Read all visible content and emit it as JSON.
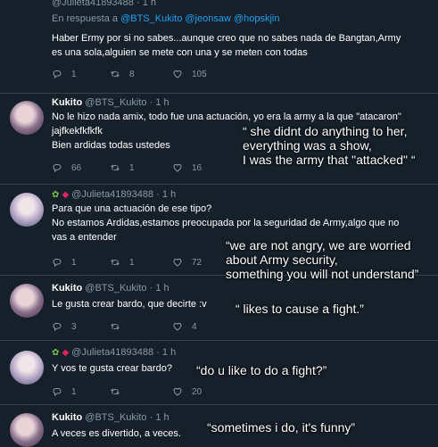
{
  "tweet1": {
    "name": "@Julieta41893488",
    "time": "· 1 h",
    "reply_prefix": "En respuesta a",
    "reply_handles": "@BTS_Kukito @jeonsaw @hopskjin",
    "line1": "Haber Ermy por si no sabes...aunque creo que no sabes nada de Bangtan,Army",
    "line2": "es una sola,alguien se mete con una y se meten con todas",
    "replies": "1",
    "retweets": "8",
    "likes": "105"
  },
  "tweet2": {
    "name": "Kukito",
    "handle": "@BTS_Kukito",
    "time": "· 1 h",
    "line1": "No le hizo nada amix, todo fue una actuación, yo era la army a la que \"atacaron\"",
    "line2": "jajfkekfkfkfk",
    "line3": "Bien ardidas todas ustedes",
    "replies": "66",
    "retweets": "1",
    "likes": "16"
  },
  "tweet3": {
    "name": "@Julieta41893488",
    "time": "· 1 h",
    "line1": "Para que una actuación de ese tipo?",
    "line2": "No estamos Ardidas,estamos preocupada por la seguridad de Army,algo que no",
    "line3": "vas a entender",
    "replies": "1",
    "retweets": "1",
    "likes": "72"
  },
  "tweet4": {
    "name": "Kukito",
    "handle": "@BTS_Kukito",
    "time": "· 1 h",
    "line1": "Le gusta crear bardo, que decirte :v",
    "replies": "3",
    "retweets": "",
    "likes": "4"
  },
  "tweet5": {
    "name": "@Julieta41893488",
    "time": "· 1 h",
    "line1": "Y vos te gusta crear bardo?",
    "replies": "1",
    "retweets": "",
    "likes": "20"
  },
  "tweet6": {
    "name": "Kukito",
    "handle": "@BTS_Kukito",
    "time": "· 1 h",
    "line1": "A veces es divertido, a veces."
  },
  "overlays": {
    "o1_l1": "“ she didnt do anything to her,",
    "o1_l2": "everything was a show,",
    "o1_l3": "I was the army that \"attacked\" “",
    "o2_l1": "“we are not angry, we are worried",
    "o2_l2": "about Army security,",
    "o2_l3": "something you will not understand”",
    "o3": "“ likes to cause a fight.”",
    "o4": "“do u like to do a fight?”",
    "o5": "“sometimes i do, it's funny”"
  },
  "colors": {
    "background": "#15202b",
    "link": "#1da1f2",
    "muted": "#8899a6",
    "divider": "#38444d"
  }
}
